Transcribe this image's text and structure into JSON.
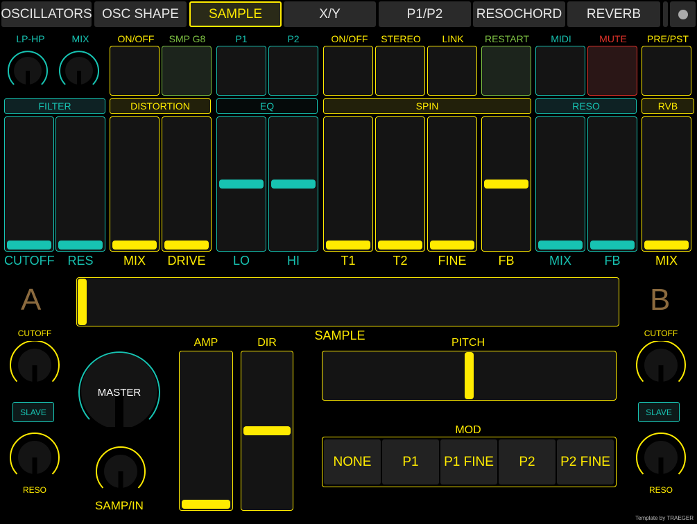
{
  "colors": {
    "yellow": "#ffeb00",
    "teal": "#17c3b2",
    "green": "#7ec243",
    "red": "#e0322a",
    "ab": "#8b6a3e"
  },
  "tabs": [
    "OSCILLATORS",
    "OSC SHAPE",
    "SAMPLE",
    "X/Y",
    "P1/P2",
    "RESOCHORD",
    "REVERB"
  ],
  "active_tab": "SAMPLE",
  "top_knobs": {
    "lp_hp": "LP-HP",
    "mix": "MIX"
  },
  "buttons": {
    "onoff": "ON/OFF",
    "smp_g8": "SMP G8",
    "p1": "P1",
    "p2": "P2",
    "onoff2": "ON/OFF",
    "stereo": "STEREO",
    "link": "LINK",
    "restart": "RESTART",
    "midi": "MIDI",
    "mute": "MUTE",
    "prepst": "PRE/PST"
  },
  "sections": {
    "filter": "FILTER",
    "distortion": "DISTORTION",
    "eq": "EQ",
    "spin": "SPIN",
    "reso": "RESO",
    "rvb": "RVB"
  },
  "faders": {
    "cutoff": "CUTOFF",
    "res": "RES",
    "mix": "MIX",
    "drive": "DRIVE",
    "lo": "LO",
    "hi": "HI",
    "t1": "T1",
    "t2": "T2",
    "fine": "FINE",
    "fb": "FB",
    "mix2": "MIX",
    "fb2": "FB",
    "mix3": "MIX"
  },
  "levels": {
    "cutoff": 0,
    "res": 0,
    "mix": 0,
    "drive": 0,
    "lo": 0.5,
    "hi": 0.5,
    "t1": 0,
    "t2": 0,
    "fine": 0,
    "fb": 0.5,
    "reso_mix": 0,
    "reso_fb": 0,
    "rvb_mix": 0,
    "sample": 0,
    "pitch": 0.5,
    "amp": 0,
    "dir": 0.5
  },
  "side": {
    "a": "A",
    "b": "B",
    "cutoff": "CUTOFF",
    "slave": "SLAVE",
    "reso": "RESO"
  },
  "sample_label": "SAMPLE",
  "master": "MASTER",
  "samp_in": "SAMP/IN",
  "amp": "AMP",
  "dir": "DIR",
  "pitch": "PITCH",
  "mod": "MOD",
  "mod_options": [
    "NONE",
    "P1",
    "P1 FINE",
    "P2",
    "P2 FINE"
  ],
  "credit": "Template by TRAEGER"
}
